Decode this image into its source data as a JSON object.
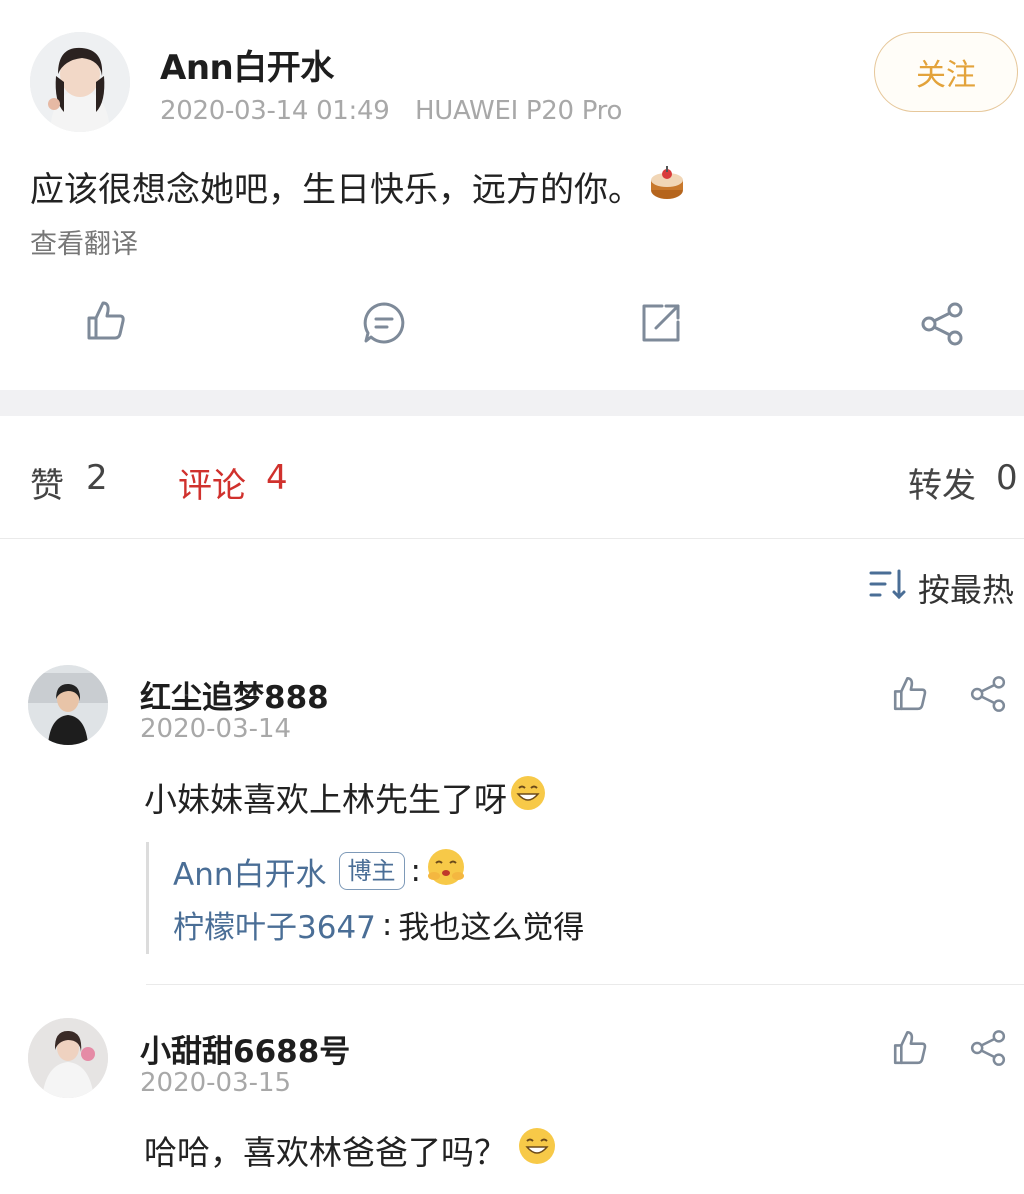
{
  "post": {
    "author": "Ann白开水",
    "timestamp": "2020-03-14 01:49",
    "device": "HUAWEI P20 Pro",
    "follow_label": "关注",
    "text": "应该很想念她吧，生日快乐，远方的你。",
    "text_emoji": "cake-emoji",
    "translate_label": "查看翻译",
    "actions": [
      "like-icon",
      "comment-icon",
      "repost-icon",
      "share-icon"
    ]
  },
  "tabs": {
    "likes_label": "赞",
    "likes_count": "2",
    "comments_label": "评论",
    "comments_count": "4",
    "reposts_label": "转发",
    "reposts_count": "0"
  },
  "sort": {
    "label": "按最热",
    "icon": "sort-icon"
  },
  "comments": [
    {
      "name": "红尘追梦888",
      "date": "2020-03-14",
      "text": "小妹妹喜欢上林先生了呀",
      "text_emoji": "grin-emoji",
      "replies": [
        {
          "user": "Ann白开水",
          "badge": "博主",
          "sep": ":",
          "text": "",
          "emoji": "hug-emoji"
        },
        {
          "user": "柠檬叶子3647",
          "sep": ":",
          "text": "我也这么觉得"
        }
      ]
    },
    {
      "name": "小甜甜6688号",
      "date": "2020-03-15",
      "text": "哈哈，喜欢林爸爸了吗？",
      "text_emoji": "smile-emoji"
    }
  ],
  "colors": {
    "accent_red": "#d0312d",
    "link_blue": "#4a6e96",
    "follow_gold": "#e3a33b"
  }
}
